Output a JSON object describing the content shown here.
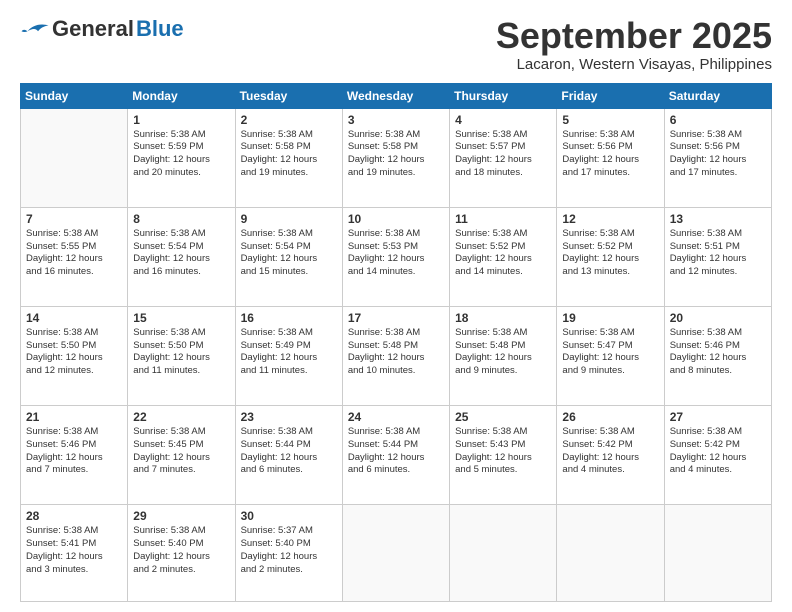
{
  "logo": {
    "part1": "General",
    "part2": "Blue"
  },
  "header": {
    "month": "September 2025",
    "location": "Lacaron, Western Visayas, Philippines"
  },
  "calendar": {
    "days": [
      "Sunday",
      "Monday",
      "Tuesday",
      "Wednesday",
      "Thursday",
      "Friday",
      "Saturday"
    ],
    "weeks": [
      [
        {
          "day": "",
          "content": ""
        },
        {
          "day": "1",
          "content": "Sunrise: 5:38 AM\nSunset: 5:59 PM\nDaylight: 12 hours\nand 20 minutes."
        },
        {
          "day": "2",
          "content": "Sunrise: 5:38 AM\nSunset: 5:58 PM\nDaylight: 12 hours\nand 19 minutes."
        },
        {
          "day": "3",
          "content": "Sunrise: 5:38 AM\nSunset: 5:58 PM\nDaylight: 12 hours\nand 19 minutes."
        },
        {
          "day": "4",
          "content": "Sunrise: 5:38 AM\nSunset: 5:57 PM\nDaylight: 12 hours\nand 18 minutes."
        },
        {
          "day": "5",
          "content": "Sunrise: 5:38 AM\nSunset: 5:56 PM\nDaylight: 12 hours\nand 17 minutes."
        },
        {
          "day": "6",
          "content": "Sunrise: 5:38 AM\nSunset: 5:56 PM\nDaylight: 12 hours\nand 17 minutes."
        }
      ],
      [
        {
          "day": "7",
          "content": "Sunrise: 5:38 AM\nSunset: 5:55 PM\nDaylight: 12 hours\nand 16 minutes."
        },
        {
          "day": "8",
          "content": "Sunrise: 5:38 AM\nSunset: 5:54 PM\nDaylight: 12 hours\nand 16 minutes."
        },
        {
          "day": "9",
          "content": "Sunrise: 5:38 AM\nSunset: 5:54 PM\nDaylight: 12 hours\nand 15 minutes."
        },
        {
          "day": "10",
          "content": "Sunrise: 5:38 AM\nSunset: 5:53 PM\nDaylight: 12 hours\nand 14 minutes."
        },
        {
          "day": "11",
          "content": "Sunrise: 5:38 AM\nSunset: 5:52 PM\nDaylight: 12 hours\nand 14 minutes."
        },
        {
          "day": "12",
          "content": "Sunrise: 5:38 AM\nSunset: 5:52 PM\nDaylight: 12 hours\nand 13 minutes."
        },
        {
          "day": "13",
          "content": "Sunrise: 5:38 AM\nSunset: 5:51 PM\nDaylight: 12 hours\nand 12 minutes."
        }
      ],
      [
        {
          "day": "14",
          "content": "Sunrise: 5:38 AM\nSunset: 5:50 PM\nDaylight: 12 hours\nand 12 minutes."
        },
        {
          "day": "15",
          "content": "Sunrise: 5:38 AM\nSunset: 5:50 PM\nDaylight: 12 hours\nand 11 minutes."
        },
        {
          "day": "16",
          "content": "Sunrise: 5:38 AM\nSunset: 5:49 PM\nDaylight: 12 hours\nand 11 minutes."
        },
        {
          "day": "17",
          "content": "Sunrise: 5:38 AM\nSunset: 5:48 PM\nDaylight: 12 hours\nand 10 minutes."
        },
        {
          "day": "18",
          "content": "Sunrise: 5:38 AM\nSunset: 5:48 PM\nDaylight: 12 hours\nand 9 minutes."
        },
        {
          "day": "19",
          "content": "Sunrise: 5:38 AM\nSunset: 5:47 PM\nDaylight: 12 hours\nand 9 minutes."
        },
        {
          "day": "20",
          "content": "Sunrise: 5:38 AM\nSunset: 5:46 PM\nDaylight: 12 hours\nand 8 minutes."
        }
      ],
      [
        {
          "day": "21",
          "content": "Sunrise: 5:38 AM\nSunset: 5:46 PM\nDaylight: 12 hours\nand 7 minutes."
        },
        {
          "day": "22",
          "content": "Sunrise: 5:38 AM\nSunset: 5:45 PM\nDaylight: 12 hours\nand 7 minutes."
        },
        {
          "day": "23",
          "content": "Sunrise: 5:38 AM\nSunset: 5:44 PM\nDaylight: 12 hours\nand 6 minutes."
        },
        {
          "day": "24",
          "content": "Sunrise: 5:38 AM\nSunset: 5:44 PM\nDaylight: 12 hours\nand 6 minutes."
        },
        {
          "day": "25",
          "content": "Sunrise: 5:38 AM\nSunset: 5:43 PM\nDaylight: 12 hours\nand 5 minutes."
        },
        {
          "day": "26",
          "content": "Sunrise: 5:38 AM\nSunset: 5:42 PM\nDaylight: 12 hours\nand 4 minutes."
        },
        {
          "day": "27",
          "content": "Sunrise: 5:38 AM\nSunset: 5:42 PM\nDaylight: 12 hours\nand 4 minutes."
        }
      ],
      [
        {
          "day": "28",
          "content": "Sunrise: 5:38 AM\nSunset: 5:41 PM\nDaylight: 12 hours\nand 3 minutes."
        },
        {
          "day": "29",
          "content": "Sunrise: 5:38 AM\nSunset: 5:40 PM\nDaylight: 12 hours\nand 2 minutes."
        },
        {
          "day": "30",
          "content": "Sunrise: 5:37 AM\nSunset: 5:40 PM\nDaylight: 12 hours\nand 2 minutes."
        },
        {
          "day": "",
          "content": ""
        },
        {
          "day": "",
          "content": ""
        },
        {
          "day": "",
          "content": ""
        },
        {
          "day": "",
          "content": ""
        }
      ]
    ]
  }
}
